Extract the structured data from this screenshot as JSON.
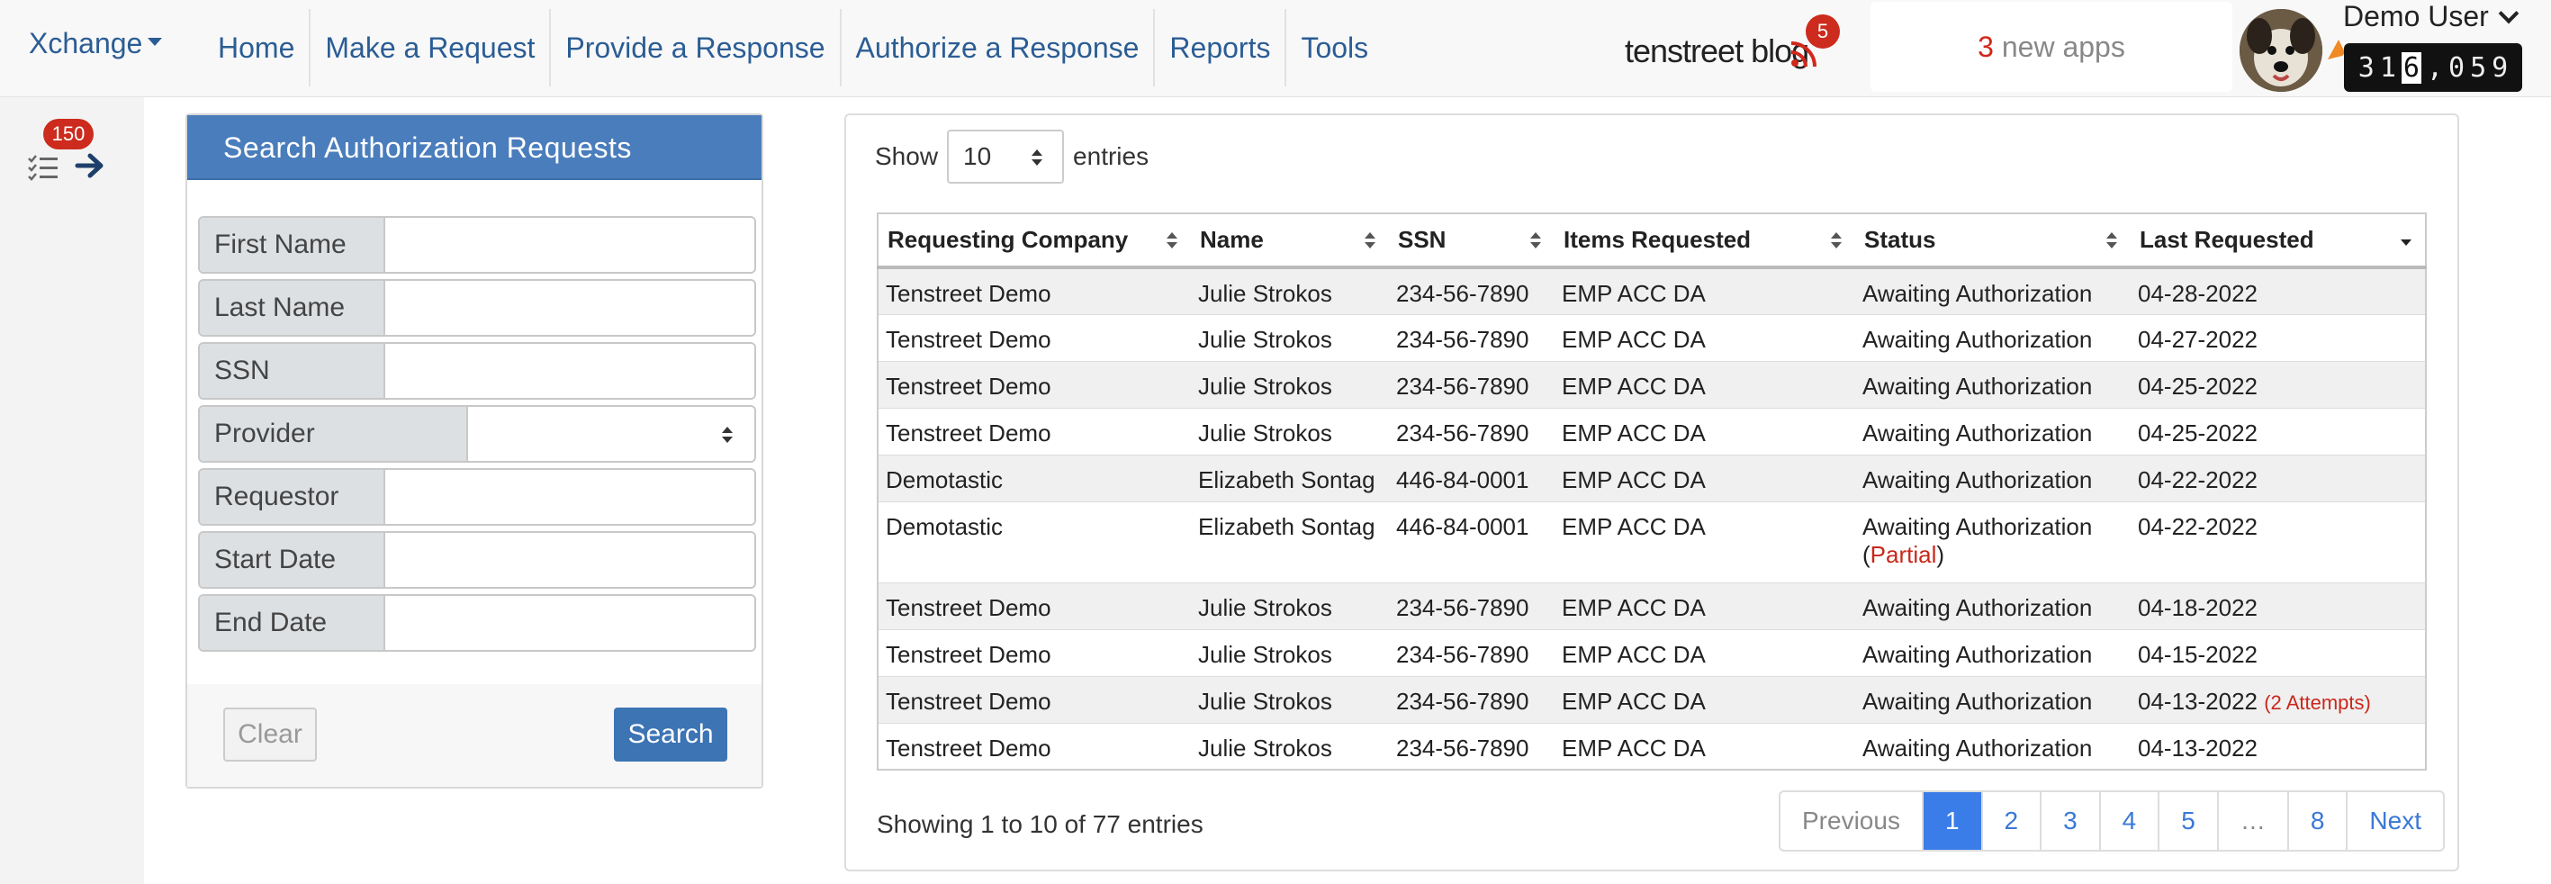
{
  "navbar": {
    "brand": "Xchange",
    "links": [
      "Home",
      "Make a Request",
      "Provide a Response",
      "Authorize a Response",
      "Reports",
      "Tools"
    ],
    "blog_label": "tenstreet blog",
    "blog_badge": "5",
    "apps_count": "3",
    "apps_text": " new apps",
    "user_name": "Demo User",
    "odometer_digits": [
      "3",
      "1",
      "6",
      ",",
      "0",
      "5",
      "9"
    ]
  },
  "rail": {
    "badge": "150"
  },
  "search": {
    "title": "Search Authorization Requests",
    "fields": [
      "First Name",
      "Last Name",
      "SSN",
      "Provider",
      "Requestor",
      "Start Date",
      "End Date"
    ],
    "clear_label": "Clear",
    "search_label": "Search"
  },
  "table": {
    "show_label": "Show",
    "length_value": "10",
    "entries_label": "entries",
    "columns": [
      "Requesting Company",
      "Name",
      "SSN",
      "Items Requested",
      "Status",
      "Last Requested"
    ],
    "rows": [
      {
        "company": "Tenstreet Demo",
        "name": "Julie Strokos",
        "ssn": "234-56-7890",
        "items": "EMP ACC DA",
        "status": "Awaiting Authorization",
        "status_extra": "",
        "date": "04-28-2022",
        "attempts": ""
      },
      {
        "company": "Tenstreet Demo",
        "name": "Julie Strokos",
        "ssn": "234-56-7890",
        "items": "EMP ACC DA",
        "status": "Awaiting Authorization",
        "status_extra": "",
        "date": "04-27-2022",
        "attempts": ""
      },
      {
        "company": "Tenstreet Demo",
        "name": "Julie Strokos",
        "ssn": "234-56-7890",
        "items": "EMP ACC DA",
        "status": "Awaiting Authorization",
        "status_extra": "",
        "date": "04-25-2022",
        "attempts": ""
      },
      {
        "company": "Tenstreet Demo",
        "name": "Julie Strokos",
        "ssn": "234-56-7890",
        "items": "EMP ACC DA",
        "status": "Awaiting Authorization",
        "status_extra": "",
        "date": "04-25-2022",
        "attempts": ""
      },
      {
        "company": "Demotastic",
        "name": "Elizabeth Sontag",
        "ssn": "446-84-0001",
        "items": "EMP ACC DA",
        "status": "Awaiting Authorization",
        "status_extra": "",
        "date": "04-22-2022",
        "attempts": ""
      },
      {
        "company": "Demotastic",
        "name": "Elizabeth Sontag",
        "ssn": "446-84-0001",
        "items": "EMP ACC DA",
        "status": "Awaiting Authorization",
        "status_extra": "Partial",
        "date": "04-22-2022",
        "attempts": ""
      },
      {
        "company": "Tenstreet Demo",
        "name": "Julie Strokos",
        "ssn": "234-56-7890",
        "items": "EMP ACC DA",
        "status": "Awaiting Authorization",
        "status_extra": "",
        "date": "04-18-2022",
        "attempts": ""
      },
      {
        "company": "Tenstreet Demo",
        "name": "Julie Strokos",
        "ssn": "234-56-7890",
        "items": "EMP ACC DA",
        "status": "Awaiting Authorization",
        "status_extra": "",
        "date": "04-15-2022",
        "attempts": ""
      },
      {
        "company": "Tenstreet Demo",
        "name": "Julie Strokos",
        "ssn": "234-56-7890",
        "items": "EMP ACC DA",
        "status": "Awaiting Authorization",
        "status_extra": "",
        "date": "04-13-2022",
        "attempts": "(2 Attempts)"
      },
      {
        "company": "Tenstreet Demo",
        "name": "Julie Strokos",
        "ssn": "234-56-7890",
        "items": "EMP ACC DA",
        "status": "Awaiting Authorization",
        "status_extra": "",
        "date": "04-13-2022",
        "attempts": ""
      }
    ],
    "info": "Showing 1 to 10 of 77 entries",
    "pagination": {
      "previous": "Previous",
      "pages": [
        "1",
        "2",
        "3",
        "4",
        "5",
        "…",
        "8"
      ],
      "next": "Next",
      "active": "1"
    }
  },
  "colors": {
    "brand_blue": "#2b5d94",
    "panel_header": "#4a7dbc",
    "badge_red": "#cc2b1d",
    "active_page": "#3a7de8"
  }
}
